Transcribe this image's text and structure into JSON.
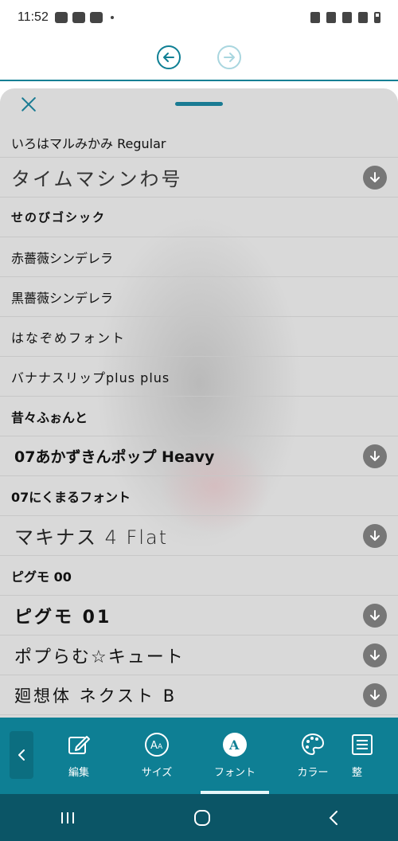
{
  "status_bar": {
    "time": "11:52"
  },
  "font_list": [
    {
      "name": "いろはマルみかみ Regular",
      "downloadable": false
    },
    {
      "name": "タイムマシンわ号",
      "downloadable": true
    },
    {
      "name": "せのびゴシック",
      "downloadable": false
    },
    {
      "name": "赤薔薇シンデレラ",
      "downloadable": false
    },
    {
      "name": "黒薔薇シンデレラ",
      "downloadable": false
    },
    {
      "name": "はなぞめフォント",
      "downloadable": false
    },
    {
      "name": "バナナスリップplus plus",
      "downloadable": false
    },
    {
      "name": "昔々ふぉんと",
      "downloadable": false
    },
    {
      "name": "07あかずきんポップ Heavy",
      "downloadable": true
    },
    {
      "name": "07にくまるフォント",
      "downloadable": false
    },
    {
      "name": "マキナス 4 Flat",
      "downloadable": true
    },
    {
      "name": "ピグモ 00",
      "downloadable": false
    },
    {
      "name": "ピグモ 01",
      "downloadable": true
    },
    {
      "name": "ポプらむ☆キュート",
      "downloadable": true
    },
    {
      "name": "廻想体 ネクスト B",
      "downloadable": true
    }
  ],
  "tabs": [
    {
      "label": "編集",
      "icon": "pencil-icon"
    },
    {
      "label": "サイズ",
      "icon": "font-size-icon"
    },
    {
      "label": "フォント",
      "icon": "font-icon",
      "active": true
    },
    {
      "label": "カラー",
      "icon": "palette-icon"
    },
    {
      "label": "整",
      "icon": "align-icon"
    }
  ],
  "colors": {
    "accent": "#0e7f94",
    "panel": "#d9d9d9",
    "nav": "#0b5566"
  }
}
